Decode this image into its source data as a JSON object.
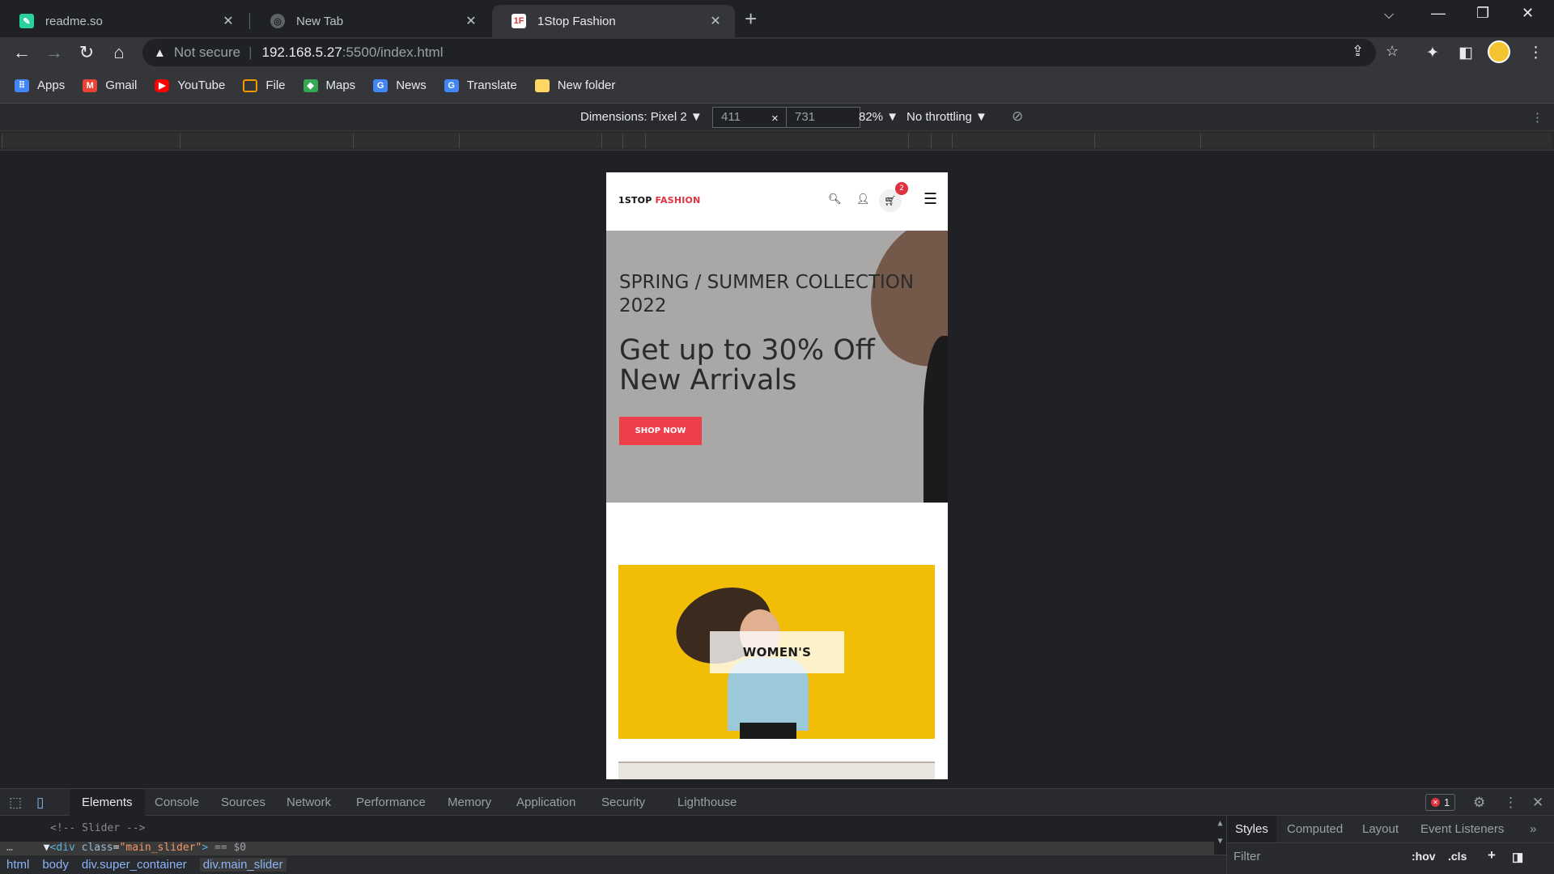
{
  "browser": {
    "tabs": [
      {
        "title": "readme.so",
        "active": false,
        "favicon": "readme-icon"
      },
      {
        "title": "New Tab",
        "active": false,
        "favicon": "globe-icon"
      },
      {
        "title": "1Stop Fashion",
        "active": true,
        "favicon": "1stop-icon"
      }
    ],
    "address": {
      "security": "Not secure",
      "host": "192.168.5.27",
      "path": ":5500/index.html"
    },
    "bookmarks": [
      {
        "label": "Apps",
        "icon": "apps-grid-icon",
        "color": "#4285f4"
      },
      {
        "label": "Gmail",
        "icon": "gmail-icon",
        "color": "#ea4335"
      },
      {
        "label": "YouTube",
        "icon": "youtube-icon",
        "color": "#ff0000"
      },
      {
        "label": "File",
        "icon": "file-icon",
        "color": "#f29900"
      },
      {
        "label": "Maps",
        "icon": "maps-icon",
        "color": "#34a853"
      },
      {
        "label": "News",
        "icon": "news-icon",
        "color": "#4285f4"
      },
      {
        "label": "Translate",
        "icon": "translate-icon",
        "color": "#4285f4"
      },
      {
        "label": "New folder",
        "icon": "folder-icon",
        "color": "#fdd663"
      }
    ]
  },
  "device_toolbar": {
    "dimensions": "Dimensions: Pixel 2 ▼",
    "width": "411",
    "times": "×",
    "height": "731",
    "zoom": "82% ▼",
    "throttling": "No throttling ▼"
  },
  "site": {
    "logo_main": "1STOP ",
    "logo_accent": "FASHION",
    "cart_count": "2",
    "hero_sub": "SPRING / SUMMER COLLECTION 2022",
    "hero_title": "Get up to 30% Off New Arrivals",
    "hero_button": "SHOP NOW",
    "category_label": "WOMEN'S",
    "accent_color": "#ef3f4b"
  },
  "devtools": {
    "tabs": [
      "Elements",
      "Console",
      "Sources",
      "Network",
      "Performance",
      "Memory",
      "Application",
      "Security",
      "Lighthouse"
    ],
    "error_count": "1",
    "dom_comment": "<!-- Slider -->",
    "dom_selected": {
      "tag": "div",
      "attr": "class",
      "value": "\"main_slider\"",
      "suffix": " == $0"
    },
    "breadcrumbs": [
      "html",
      "body",
      "div.super_container",
      "div.main_slider"
    ],
    "side_tabs": [
      "Styles",
      "Computed",
      "Layout",
      "Event Listeners"
    ],
    "filter_placeholder": "Filter",
    "hov": ":hov",
    "cls": ".cls"
  }
}
